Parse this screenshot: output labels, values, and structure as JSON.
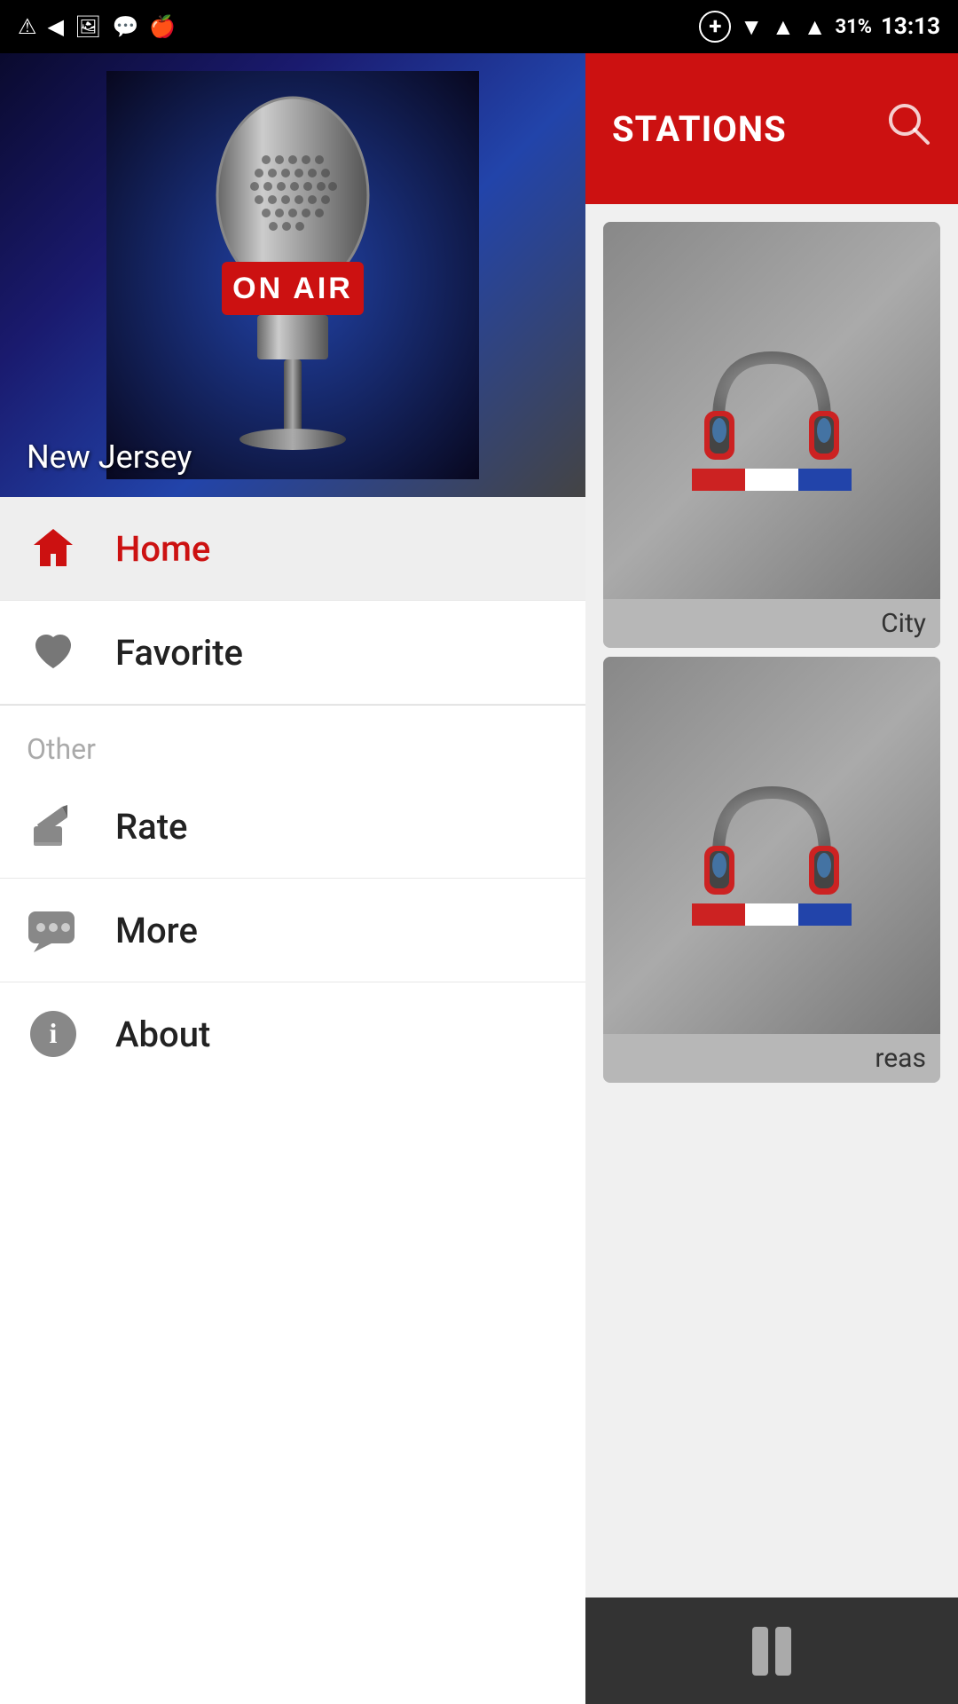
{
  "statusBar": {
    "time": "13:13",
    "battery": "31%"
  },
  "hero": {
    "location": "New Jersey",
    "onAirText": "ON AIR"
  },
  "menu": {
    "homeLabel": "Home",
    "favoriteLabel": "Favorite",
    "otherLabel": "Other",
    "rateLabel": "Rate",
    "moreLabel": "More",
    "aboutLabel": "About"
  },
  "rightPanel": {
    "title": "STATIONS",
    "card1Location": "City",
    "card2Location": "reas",
    "searchIconLabel": "search"
  }
}
